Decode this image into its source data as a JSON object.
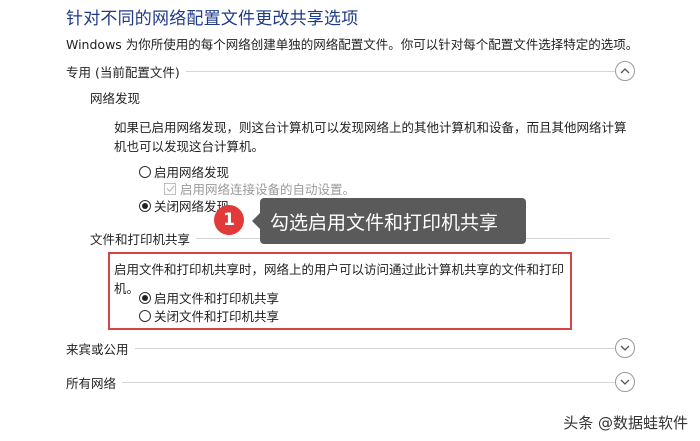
{
  "header": {
    "title": "针对不同的网络配置文件更改共享选项",
    "description": "Windows 为你所使用的每个网络创建单独的网络配置文件。你可以针对每个配置文件选择特定的选项。"
  },
  "private_profile": {
    "label": "专用 (当前配置文件)",
    "network_discovery": {
      "heading": "网络发现",
      "description": "如果已启用网络发现，则这台计算机可以发现网络上的其他计算机和设备，而且其他网络计算机也可以发现这台计算机。",
      "option_on": "启用网络发现",
      "auto_setup": "启用网络连接设备的自动设置。",
      "option_off": "关闭网络发现",
      "selected": "off"
    },
    "file_printer_sharing": {
      "heading": "文件和打印机共享",
      "description": "启用文件和打印机共享时，网络上的用户可以访问通过此计算机共享的文件和打印机。",
      "option_on": "启用文件和打印机共享",
      "option_off": "关闭文件和打印机共享",
      "selected": "on"
    }
  },
  "guest_profile": {
    "label": "来宾或公用"
  },
  "all_networks": {
    "label": "所有网络"
  },
  "annotation": {
    "step_number": "1",
    "text": "勾选启用文件和打印机共享",
    "highlight_color": "#d64545",
    "badge_color": "#e23a3a"
  },
  "watermark": "头条 @数据蛙软件",
  "icons": {
    "expanded": "chevron-up-icon",
    "collapsed": "chevron-down-icon"
  }
}
